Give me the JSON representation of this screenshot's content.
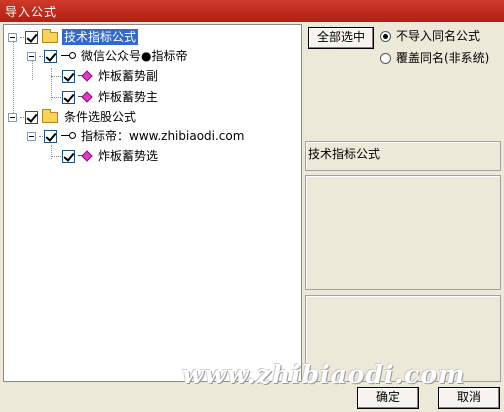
{
  "window": {
    "title": "导入公式"
  },
  "tree": {
    "nodes": [
      {
        "label": "技术指标公式",
        "selected": true,
        "checked": true
      },
      {
        "label": "微信公众号●指标帝",
        "checked": true
      },
      {
        "label": "炸板蓄势副",
        "checked": true
      },
      {
        "label": "炸板蓄势主",
        "checked": true
      },
      {
        "label": "条件选股公式",
        "checked": true
      },
      {
        "label": "指标帝：www.zhibiaodi.com",
        "checked": true
      },
      {
        "label": "炸板蓄势选",
        "checked": true
      }
    ]
  },
  "options": {
    "select_all_label": "全部选中",
    "radio_skip_label": "不导入同名公式",
    "radio_overwrite_label": "覆盖同名(非系统)",
    "selected": "skip"
  },
  "info_panel": {
    "title": "技术指标公式"
  },
  "footer": {
    "ok_label": "确定",
    "cancel_label": "取消"
  },
  "watermark": "www.zhibiaodi.com",
  "colors": {
    "titlebar": "#b11f14",
    "selection": "#316ac5",
    "formula_icon": "#e03cc9"
  }
}
